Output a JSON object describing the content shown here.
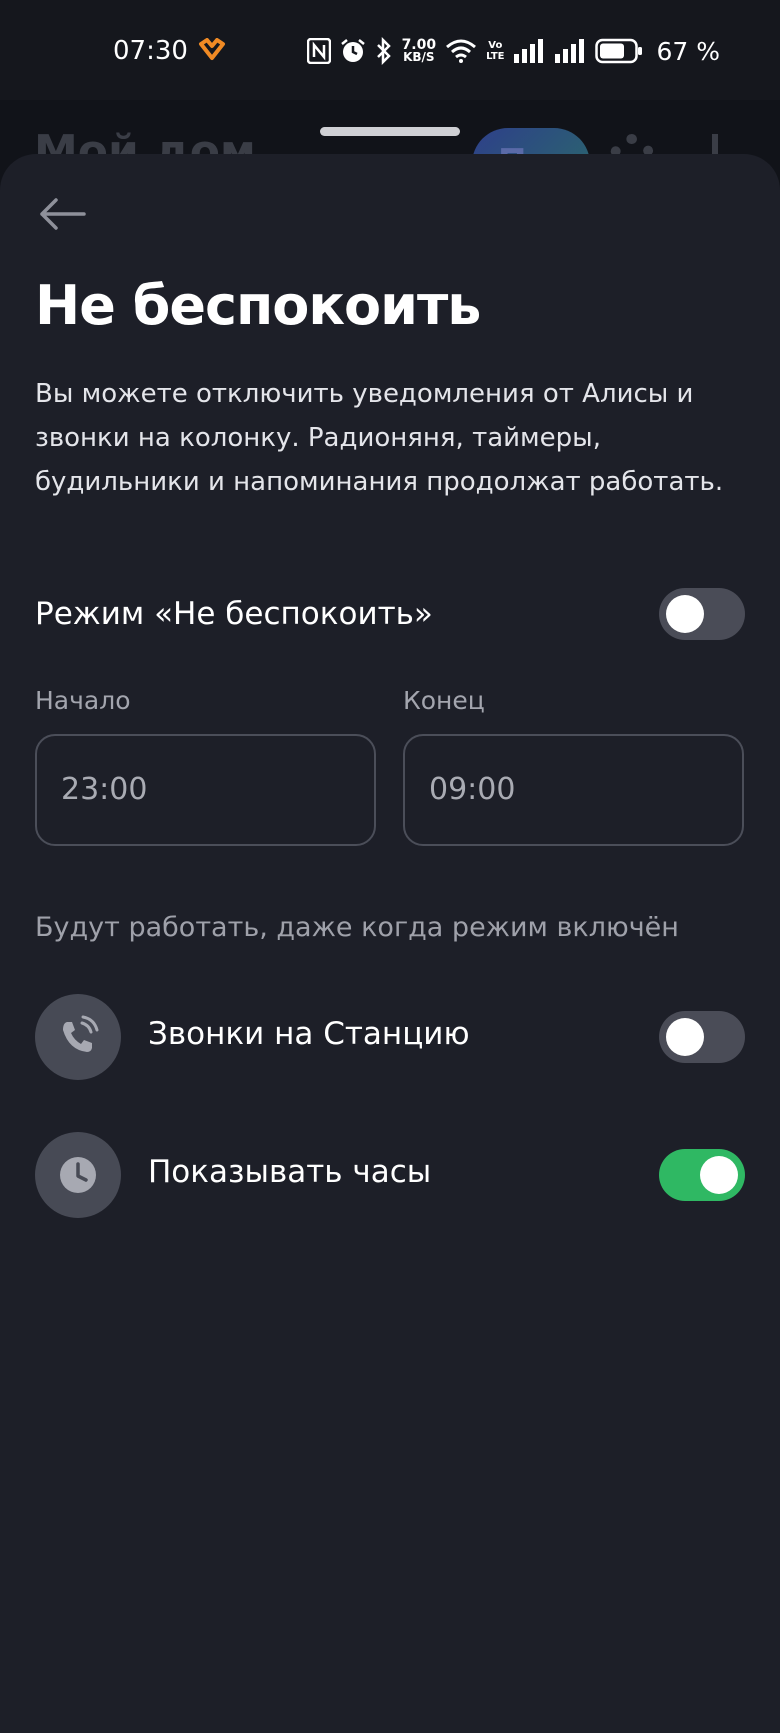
{
  "status_bar": {
    "time": "07:30",
    "net_speed_value": "7.00",
    "net_speed_unit": "KB/S",
    "volte_top": "Vo",
    "volte_bottom": "LTE",
    "battery_percent": "67 %",
    "icons": [
      "nfc-icon",
      "alarm-icon",
      "bluetooth-icon",
      "wifi-icon",
      "signal-icon",
      "battery-icon"
    ]
  },
  "background": {
    "title_partial": "Мой дом",
    "pill_partial": "Про"
  },
  "sheet": {
    "title": "Не беспокоить",
    "description": "Вы можете отключить уведомления от Алисы и звонки на колонку. Радионяня, таймеры, будильники и напоминания продолжат работать.",
    "dnd_mode": {
      "label": "Режим «Не беспокоить»",
      "enabled": false
    },
    "start": {
      "label": "Начало",
      "value": "23:00"
    },
    "end": {
      "label": "Конец",
      "value": "09:00"
    },
    "exceptions_caption": "Будут работать, даже когда режим включён",
    "exceptions": [
      {
        "label": "Звонки на Станцию",
        "icon": "phone-ringing-icon",
        "enabled": false
      },
      {
        "label": "Показывать часы",
        "icon": "clock-icon",
        "enabled": true
      }
    ]
  },
  "colors": {
    "sheet_bg": "#1d1f28",
    "toggle_on": "#2fb863",
    "toggle_off": "#4a4c57",
    "app_icon_accent": "#f08a24"
  }
}
